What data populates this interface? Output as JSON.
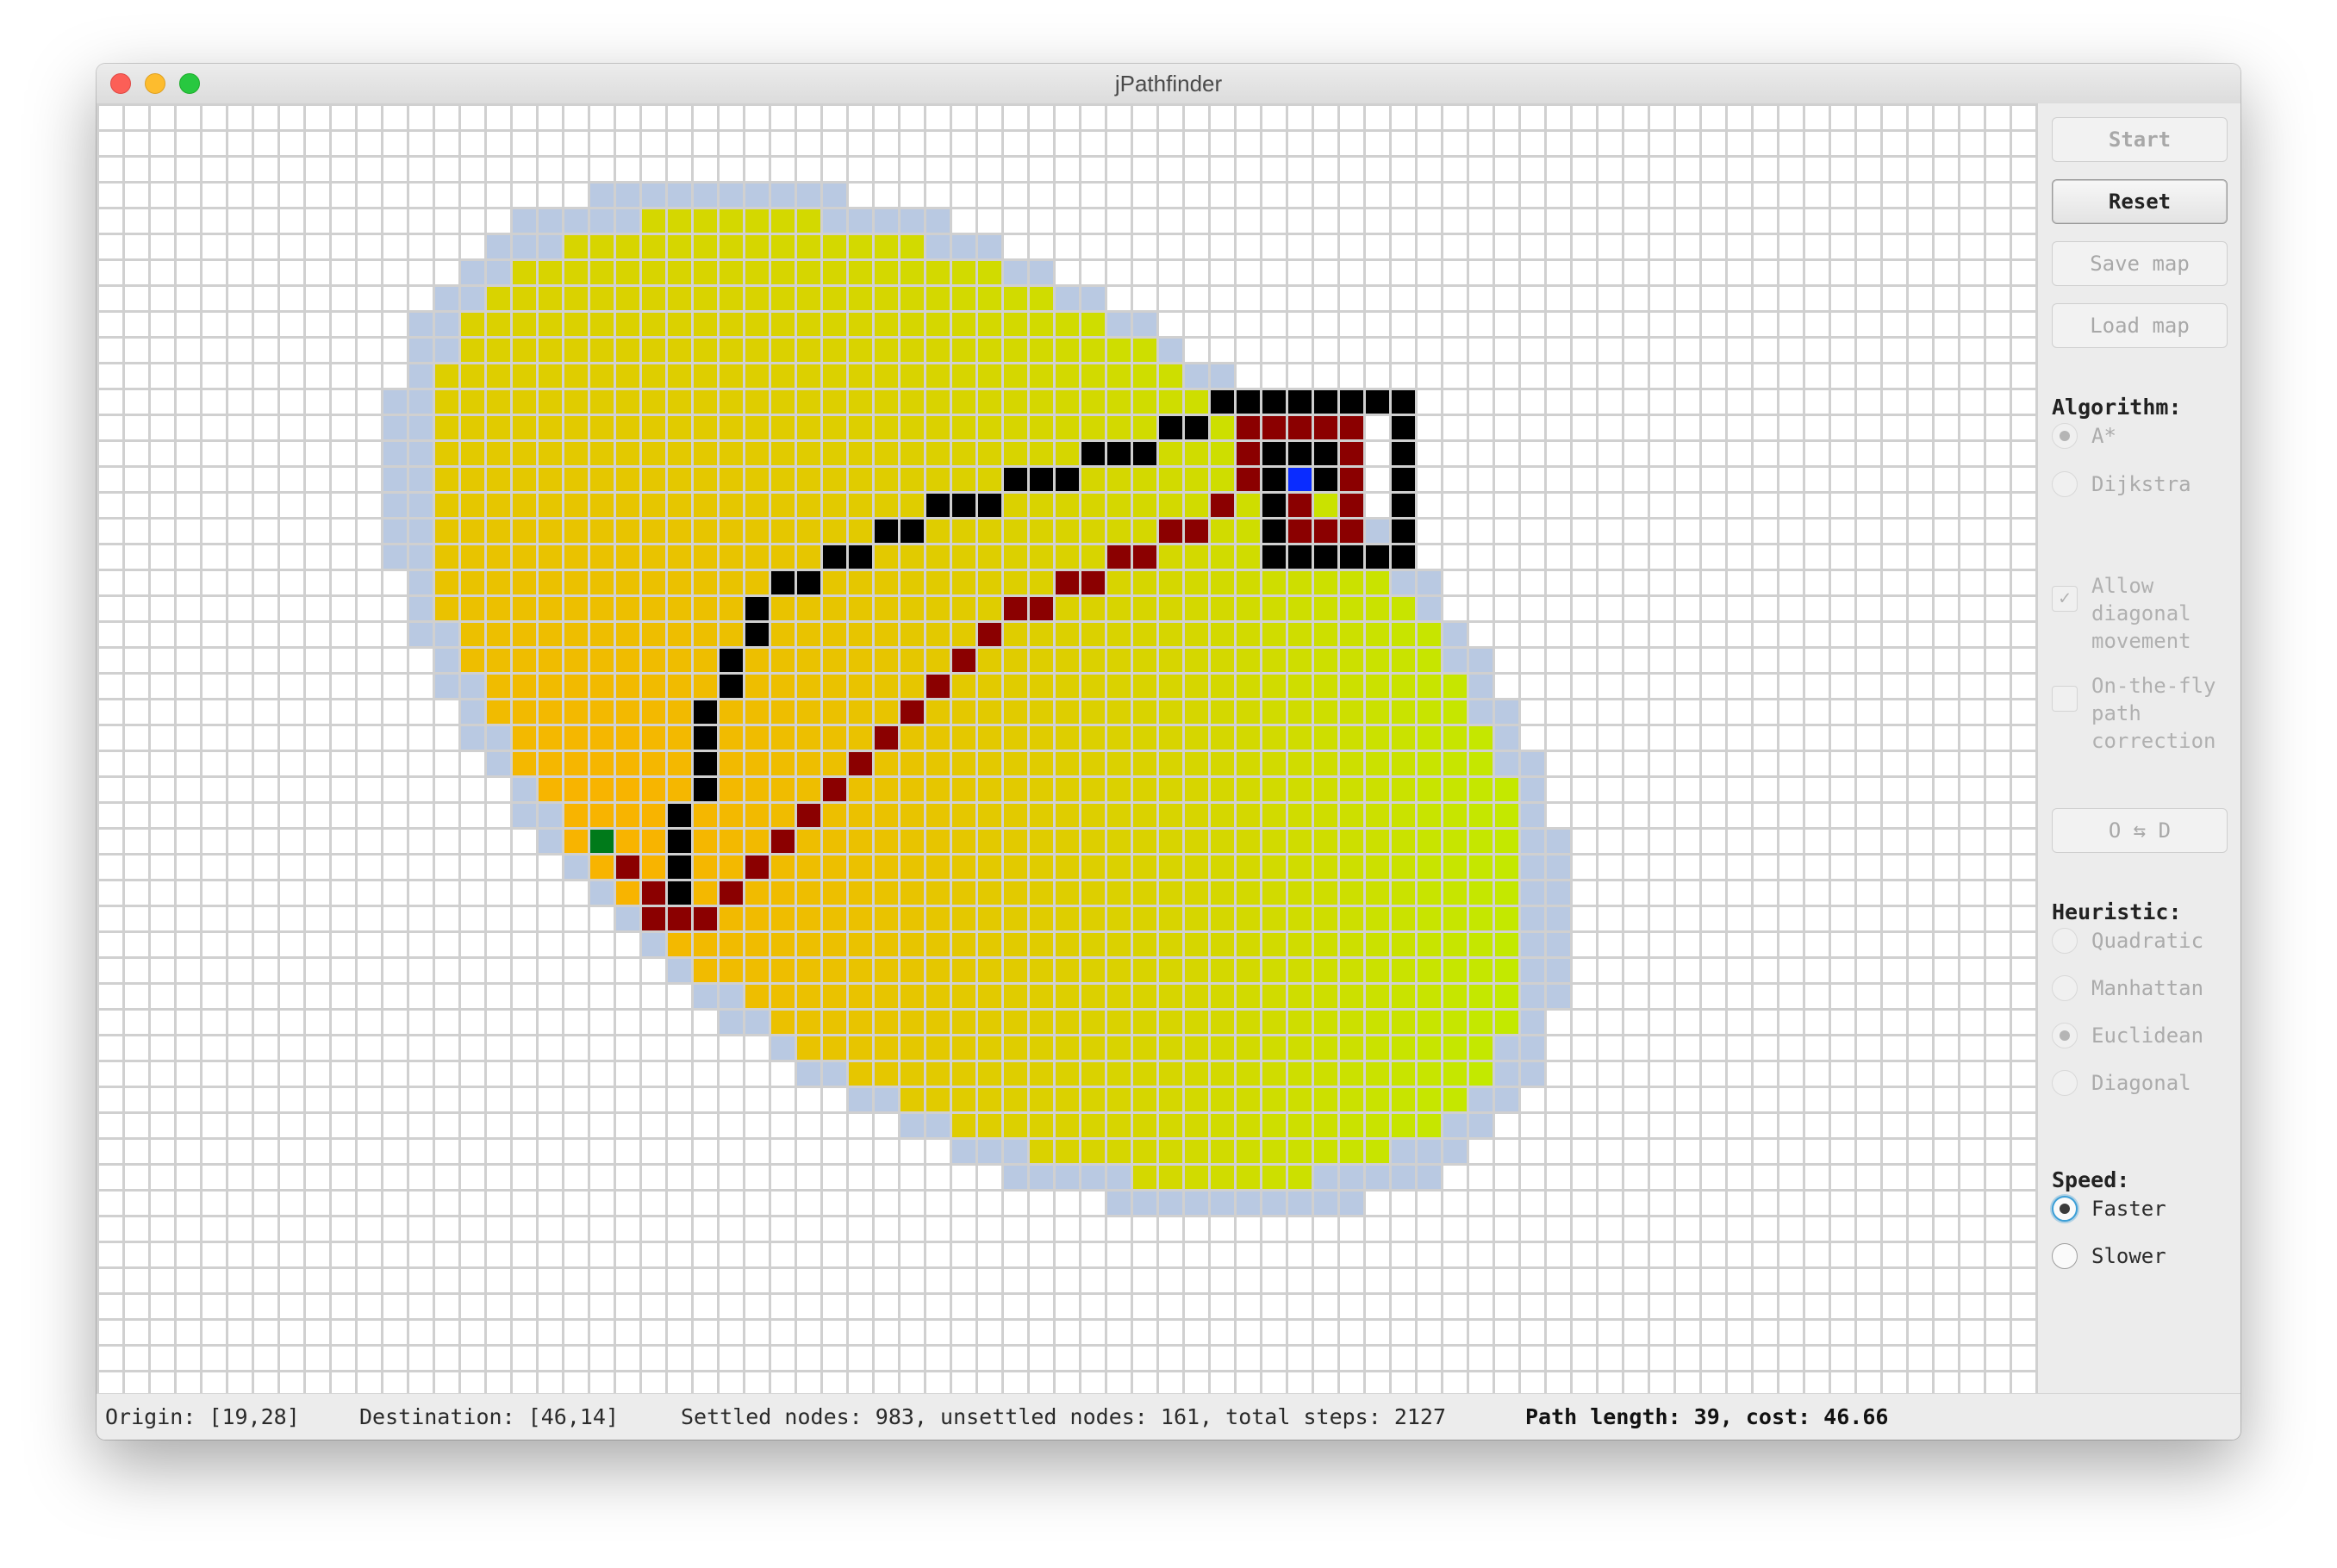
{
  "window": {
    "title": "jPathfinder"
  },
  "sidebar": {
    "buttons": {
      "start": "Start",
      "reset": "Reset",
      "save_map": "Save map",
      "load_map": "Load map",
      "swap": "O ⇆ D"
    },
    "algorithm": {
      "label": "Algorithm:",
      "options": [
        "A*",
        "Dijkstra"
      ],
      "selected": "A*"
    },
    "checkboxes": {
      "diagonal": "Allow\ndiagonal\nmovement",
      "diagonal_checked": true,
      "correction": "On-the-fly\npath\ncorrection",
      "correction_checked": false
    },
    "heuristic": {
      "label": "Heuristic:",
      "options": [
        "Quadratic",
        "Manhattan",
        "Euclidean",
        "Diagonal"
      ],
      "selected": "Euclidean"
    },
    "speed": {
      "label": "Speed:",
      "options": [
        "Faster",
        "Slower"
      ],
      "selected": "Faster"
    }
  },
  "status": {
    "origin": "Origin: [19,28]",
    "destination": "Destination: [46,14]",
    "nodes": "Settled nodes: 983, unsettled nodes: 161, total steps: 2127",
    "path": "Path length: 39, cost: 46.66"
  },
  "grid": {
    "columns": 75,
    "rows": 50,
    "origin": [
      19,
      28
    ],
    "destination": [
      46,
      14
    ],
    "colors": {
      "empty": "#ffffff",
      "grid_line": "#d0d0d0",
      "wall": "#000000",
      "path": "#8b0000",
      "origin": "#007a1a",
      "destination": "#0a2cff",
      "frontier": "#b9c9e2",
      "settled_near": "#f8b400",
      "settled_far": "#b8f400"
    },
    "walls": [
      [
        43,
        11
      ],
      [
        44,
        11
      ],
      [
        45,
        11
      ],
      [
        46,
        11
      ],
      [
        47,
        11
      ],
      [
        48,
        11
      ],
      [
        49,
        11
      ],
      [
        50,
        11
      ],
      [
        41,
        12
      ],
      [
        42,
        12
      ],
      [
        50,
        12
      ],
      [
        38,
        13
      ],
      [
        39,
        13
      ],
      [
        40,
        13
      ],
      [
        45,
        13
      ],
      [
        46,
        13
      ],
      [
        47,
        13
      ],
      [
        50,
        13
      ],
      [
        35,
        14
      ],
      [
        36,
        14
      ],
      [
        37,
        14
      ],
      [
        45,
        14
      ],
      [
        47,
        14
      ],
      [
        50,
        14
      ],
      [
        32,
        15
      ],
      [
        33,
        15
      ],
      [
        34,
        15
      ],
      [
        45,
        15
      ],
      [
        50,
        15
      ],
      [
        30,
        16
      ],
      [
        31,
        16
      ],
      [
        45,
        16
      ],
      [
        50,
        16
      ],
      [
        28,
        17
      ],
      [
        29,
        17
      ],
      [
        45,
        17
      ],
      [
        46,
        17
      ],
      [
        47,
        17
      ],
      [
        48,
        17
      ],
      [
        49,
        17
      ],
      [
        50,
        17
      ],
      [
        26,
        18
      ],
      [
        27,
        18
      ],
      [
        25,
        19
      ],
      [
        25,
        20
      ],
      [
        24,
        21
      ],
      [
        24,
        22
      ],
      [
        23,
        23
      ],
      [
        23,
        24
      ],
      [
        23,
        25
      ],
      [
        23,
        26
      ],
      [
        22,
        27
      ],
      [
        22,
        28
      ],
      [
        22,
        29
      ],
      [
        22,
        30
      ]
    ],
    "path": [
      [
        20,
        29
      ],
      [
        21,
        30
      ],
      [
        21,
        31
      ],
      [
        22,
        31
      ],
      [
        23,
        31
      ],
      [
        24,
        30
      ],
      [
        25,
        29
      ],
      [
        26,
        28
      ],
      [
        27,
        27
      ],
      [
        28,
        26
      ],
      [
        29,
        25
      ],
      [
        30,
        24
      ],
      [
        31,
        23
      ],
      [
        32,
        22
      ],
      [
        33,
        21
      ],
      [
        34,
        20
      ],
      [
        35,
        19
      ],
      [
        36,
        19
      ],
      [
        37,
        18
      ],
      [
        38,
        18
      ],
      [
        39,
        17
      ],
      [
        40,
        17
      ],
      [
        41,
        16
      ],
      [
        42,
        16
      ],
      [
        43,
        15
      ],
      [
        44,
        14
      ],
      [
        44,
        13
      ],
      [
        44,
        12
      ],
      [
        45,
        12
      ],
      [
        46,
        12
      ],
      [
        47,
        12
      ],
      [
        48,
        12
      ],
      [
        48,
        13
      ],
      [
        48,
        14
      ],
      [
        48,
        15
      ],
      [
        48,
        16
      ],
      [
        47,
        16
      ],
      [
        46,
        16
      ],
      [
        46,
        15
      ]
    ],
    "settled_ellipse": {
      "center": [
        33.5,
        22.5
      ],
      "radius_major": 24.5,
      "radius_minor": 14.8,
      "angle_deg": -37,
      "frontier_width": 1.0
    }
  }
}
